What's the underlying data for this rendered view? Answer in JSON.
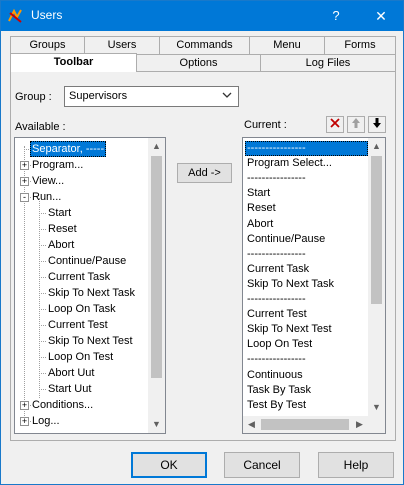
{
  "window": {
    "title": "Users",
    "help_label": "?",
    "close_label": "✕"
  },
  "tabs_row1": [
    "Groups",
    "Users",
    "Commands",
    "Menu",
    "Forms"
  ],
  "tabs_row2": [
    "Toolbar",
    "Options",
    "Log Files"
  ],
  "active_tab": "Toolbar",
  "group": {
    "label": "Group :",
    "value": "Supervisors"
  },
  "available": {
    "label": "Available :",
    "items": [
      {
        "text": "Separator, -----",
        "level": 0,
        "expander": "",
        "selected": true
      },
      {
        "text": "Program...",
        "level": 0,
        "expander": "+"
      },
      {
        "text": "View...",
        "level": 0,
        "expander": "+"
      },
      {
        "text": "Run...",
        "level": 0,
        "expander": "-"
      },
      {
        "text": "Start",
        "level": 1
      },
      {
        "text": "Reset",
        "level": 1
      },
      {
        "text": "Abort",
        "level": 1
      },
      {
        "text": "Continue/Pause",
        "level": 1
      },
      {
        "text": "Current Task",
        "level": 1
      },
      {
        "text": "Skip To Next Task",
        "level": 1
      },
      {
        "text": "Loop On Task",
        "level": 1
      },
      {
        "text": "Current Test",
        "level": 1
      },
      {
        "text": "Skip To Next Test",
        "level": 1
      },
      {
        "text": "Loop On Test",
        "level": 1
      },
      {
        "text": "Abort Uut",
        "level": 1
      },
      {
        "text": "Start Uut",
        "level": 1
      },
      {
        "text": "Conditions...",
        "level": 0,
        "expander": "+"
      },
      {
        "text": "Log...",
        "level": 0,
        "expander": "+"
      }
    ]
  },
  "add_button": "Add ->",
  "current": {
    "label": "Current :",
    "items": [
      {
        "text": "----------------",
        "selected": true
      },
      {
        "text": "Program Select..."
      },
      {
        "text": "----------------"
      },
      {
        "text": "Start"
      },
      {
        "text": "Reset"
      },
      {
        "text": "Abort"
      },
      {
        "text": "Continue/Pause"
      },
      {
        "text": "----------------"
      },
      {
        "text": "Current Task"
      },
      {
        "text": "Skip To Next Task"
      },
      {
        "text": "----------------"
      },
      {
        "text": "Current Test"
      },
      {
        "text": "Skip To Next Test"
      },
      {
        "text": "Loop On Test"
      },
      {
        "text": "----------------"
      },
      {
        "text": "Continuous"
      },
      {
        "text": "Task By Task"
      },
      {
        "text": "Test By Test"
      }
    ]
  },
  "buttons": {
    "ok": "OK",
    "cancel": "Cancel",
    "help": "Help"
  },
  "colors": {
    "titlebar": "#0078d7",
    "selection": "#0078d7",
    "delete_icon": "#c00000"
  }
}
